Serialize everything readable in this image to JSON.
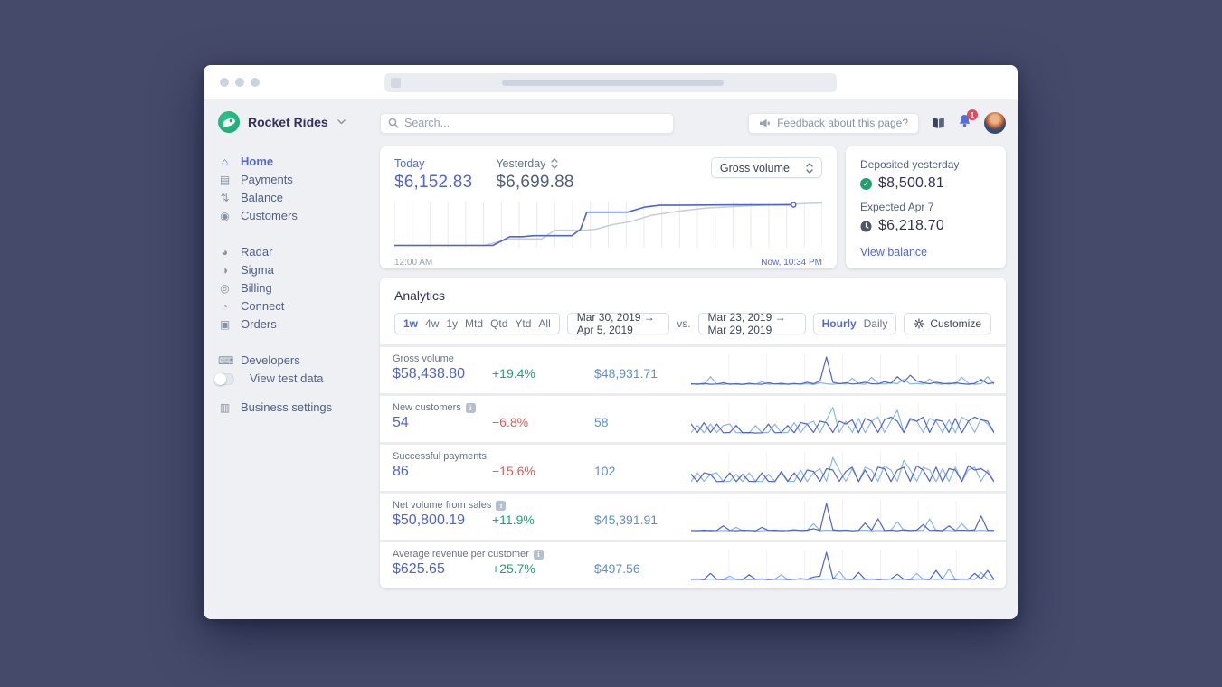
{
  "colors": {
    "accent": "#4f63d2",
    "comparison_text": "#5d8fdb",
    "spark_previous": "#8ab6ef",
    "yesterday_line": "#c7cdd8",
    "positive": "#1ba672",
    "negative": "#e25950"
  },
  "sidebar": {
    "account_name": "Rocket Rides",
    "nav_main": [
      {
        "label": "Home",
        "glyph": "⌂",
        "active": true
      },
      {
        "label": "Payments",
        "glyph": "▤"
      },
      {
        "label": "Balance",
        "glyph": "⇅"
      },
      {
        "label": "Customers",
        "glyph": "◉"
      }
    ],
    "nav_products": [
      {
        "label": "Radar",
        "glyph": "◕"
      },
      {
        "label": "Sigma",
        "glyph": "◑"
      },
      {
        "label": "Billing",
        "glyph": "◎"
      },
      {
        "label": "Connect",
        "glyph": "◔"
      },
      {
        "label": "Orders",
        "glyph": "▣"
      }
    ],
    "nav_dev": [
      {
        "label": "Developers",
        "glyph": "⌨"
      }
    ],
    "test_toggle_label": "View test data",
    "nav_settings": [
      {
        "label": "Business settings",
        "glyph": "▥"
      }
    ]
  },
  "topbar": {
    "search_placeholder": "Search...",
    "feedback_label": "Feedback about this page?",
    "notification_count": "1"
  },
  "overview": {
    "today_label": "Today",
    "today_value": "$6,152.83",
    "yesterday_label": "Yesterday",
    "yesterday_value": "$6,699.88",
    "metric_select": "Gross volume",
    "x_start": "12:00 AM",
    "x_end": "Now, 10:34 PM",
    "chart": {
      "today": [
        [
          0,
          0.05
        ],
        [
          0.23,
          0.05
        ],
        [
          0.27,
          0.24
        ],
        [
          0.3,
          0.24
        ],
        [
          0.325,
          0.26
        ],
        [
          0.415,
          0.26
        ],
        [
          0.435,
          0.4
        ],
        [
          0.45,
          0.77
        ],
        [
          0.545,
          0.77
        ],
        [
          0.585,
          0.88
        ],
        [
          0.62,
          0.92
        ],
        [
          0.8,
          0.93
        ],
        [
          0.933,
          0.93
        ]
      ],
      "yesterday": [
        [
          0,
          0.05
        ],
        [
          0.21,
          0.05
        ],
        [
          0.27,
          0.19
        ],
        [
          0.345,
          0.19
        ],
        [
          0.375,
          0.38
        ],
        [
          0.44,
          0.38
        ],
        [
          0.47,
          0.4
        ],
        [
          0.51,
          0.5
        ],
        [
          0.55,
          0.56
        ],
        [
          0.6,
          0.7
        ],
        [
          0.67,
          0.8
        ],
        [
          0.73,
          0.86
        ],
        [
          0.83,
          0.91
        ],
        [
          1.0,
          0.97
        ]
      ]
    }
  },
  "deposits": {
    "deposited_label": "Deposited yesterday",
    "deposited_value": "$8,500.81",
    "expected_label": "Expected Apr 7",
    "expected_value": "$6,218.70",
    "link_label": "View balance"
  },
  "analytics": {
    "title": "Analytics",
    "periods": [
      "1w",
      "4w",
      "1y",
      "Mtd",
      "Qtd",
      "Ytd",
      "All"
    ],
    "active_period": "1w",
    "range_current": "Mar 30, 2019 →  Apr 5, 2019",
    "vs_label": "vs.",
    "range_previous": "Mar 23, 2019 → Mar 29, 2019",
    "granularities": [
      "Hourly",
      "Daily"
    ],
    "active_granularity": "Hourly",
    "customize_label": "Customize",
    "rows": [
      {
        "label": "Gross volume",
        "info": false,
        "current": "$58,438.80",
        "delta": "+19.4%",
        "positive": true,
        "previous": "$48,931.71",
        "spark_current": [
          0.05,
          0.03,
          0.06,
          0.03,
          0.04,
          0.08,
          0.03,
          0.05,
          0.03,
          0.06,
          0.04,
          0.03,
          0.08,
          0.04,
          0.06,
          0.03,
          0.05,
          0.04,
          0.1,
          0.05,
          0.15,
          1.0,
          0.1,
          0.05,
          0.08,
          0.04,
          0.06,
          0.1,
          0.05,
          0.04,
          0.12,
          0.06,
          0.3,
          0.1,
          0.35,
          0.15,
          0.08,
          0.05,
          0.1,
          0.06,
          0.04,
          0.08,
          0.05,
          0.03,
          0.06,
          0.2,
          0.05,
          0.08
        ],
        "spark_previous": [
          0.03,
          0.05,
          0.02,
          0.3,
          0.04,
          0.02,
          0.05,
          0.03,
          0.02,
          0.04,
          0.03,
          0.12,
          0.03,
          0.05,
          0.02,
          0.04,
          0.06,
          0.03,
          0.05,
          0.02,
          0.08,
          0.05,
          0.03,
          0.06,
          0.04,
          0.25,
          0.05,
          0.03,
          0.28,
          0.06,
          0.04,
          0.08,
          0.05,
          0.2,
          0.04,
          0.06,
          0.03,
          0.22,
          0.05,
          0.03,
          0.08,
          0.04,
          0.28,
          0.06,
          0.03,
          0.05,
          0.3,
          0.04
        ]
      },
      {
        "label": "New customers",
        "info": true,
        "current": "54",
        "delta": "−6.8%",
        "positive": false,
        "previous": "58",
        "spark_current": [
          0.35,
          0.05,
          0.4,
          0.05,
          0.35,
          0.04,
          0.05,
          0.3,
          0.04,
          0.05,
          0.03,
          0.04,
          0.35,
          0.04,
          0.05,
          0.3,
          0.04,
          0.4,
          0.35,
          0.05,
          0.45,
          0.4,
          0.05,
          0.45,
          0.35,
          0.5,
          0.04,
          0.55,
          0.45,
          0.05,
          0.5,
          0.6,
          0.45,
          0.05,
          0.55,
          0.45,
          0.6,
          0.05,
          0.5,
          0.45,
          0.05,
          0.55,
          0.04,
          0.45,
          0.6,
          0.5,
          0.45,
          0.05
        ],
        "spark_previous": [
          0.05,
          0.3,
          0.04,
          0.35,
          0.05,
          0.3,
          0.35,
          0.04,
          0.05,
          0.03,
          0.3,
          0.04,
          0.05,
          0.35,
          0.04,
          0.05,
          0.4,
          0.05,
          0.35,
          0.45,
          0.05,
          0.5,
          0.95,
          0.05,
          0.45,
          0.05,
          0.55,
          0.04,
          0.45,
          0.6,
          0.05,
          0.45,
          0.85,
          0.05,
          0.5,
          0.45,
          0.05,
          0.55,
          0.45,
          0.05,
          0.5,
          0.04,
          0.6,
          0.45,
          0.05,
          0.55,
          0.35,
          0.04
        ]
      },
      {
        "label": "Successful payments",
        "info": false,
        "current": "86",
        "delta": "−15.6%",
        "positive": false,
        "previous": "102",
        "spark_current": [
          0.3,
          0.04,
          0.35,
          0.3,
          0.04,
          0.05,
          0.35,
          0.04,
          0.3,
          0.05,
          0.04,
          0.35,
          0.05,
          0.04,
          0.4,
          0.05,
          0.35,
          0.04,
          0.45,
          0.4,
          0.05,
          0.5,
          0.45,
          0.05,
          0.4,
          0.55,
          0.04,
          0.45,
          0.05,
          0.55,
          0.5,
          0.04,
          0.45,
          0.55,
          0.05,
          0.6,
          0.45,
          0.05,
          0.55,
          0.04,
          0.5,
          0.45,
          0.05,
          0.6,
          0.45,
          0.5,
          0.35,
          0.04
        ],
        "spark_previous": [
          0.04,
          0.35,
          0.05,
          0.3,
          0.35,
          0.04,
          0.05,
          0.3,
          0.04,
          0.35,
          0.05,
          0.04,
          0.3,
          0.05,
          0.35,
          0.04,
          0.05,
          0.45,
          0.04,
          0.35,
          0.5,
          0.05,
          0.9,
          0.45,
          0.05,
          0.5,
          0.04,
          0.55,
          0.45,
          0.05,
          0.6,
          0.45,
          0.05,
          0.8,
          0.45,
          0.05,
          0.55,
          0.45,
          0.04,
          0.5,
          0.05,
          0.55,
          0.04,
          0.45,
          0.55,
          0.05,
          0.45,
          0.04
        ]
      },
      {
        "label": "Net volume from sales",
        "info": true,
        "current": "$50,800.19",
        "delta": "+11.9%",
        "positive": true,
        "previous": "$45,391.91",
        "spark_current": [
          0.04,
          0.03,
          0.05,
          0.03,
          0.04,
          0.2,
          0.04,
          0.03,
          0.05,
          0.04,
          0.03,
          0.15,
          0.04,
          0.05,
          0.03,
          0.04,
          0.06,
          0.04,
          0.05,
          0.1,
          0.04,
          1.0,
          0.06,
          0.04,
          0.05,
          0.03,
          0.04,
          0.3,
          0.05,
          0.45,
          0.04,
          0.05,
          0.03,
          0.06,
          0.04,
          0.05,
          0.25,
          0.04,
          0.05,
          0.03,
          0.2,
          0.04,
          0.05,
          0.04,
          0.06,
          0.55,
          0.05,
          0.04
        ],
        "spark_previous": [
          0.03,
          0.04,
          0.02,
          0.05,
          0.03,
          0.04,
          0.03,
          0.15,
          0.03,
          0.04,
          0.02,
          0.03,
          0.05,
          0.03,
          0.04,
          0.03,
          0.05,
          0.03,
          0.04,
          0.28,
          0.03,
          0.05,
          0.04,
          0.03,
          0.05,
          0.03,
          0.04,
          0.05,
          0.03,
          0.04,
          0.03,
          0.05,
          0.35,
          0.04,
          0.03,
          0.05,
          0.04,
          0.45,
          0.03,
          0.05,
          0.04,
          0.03,
          0.28,
          0.04,
          0.03,
          0.05,
          0.03,
          0.04
        ]
      },
      {
        "label": "Average revenue per customer",
        "info": true,
        "current": "$625.65",
        "delta": "+25.7%",
        "positive": true,
        "previous": "$497.56",
        "spark_current": [
          0.04,
          0.05,
          0.03,
          0.25,
          0.04,
          0.03,
          0.05,
          0.04,
          0.03,
          0.2,
          0.04,
          0.05,
          0.03,
          0.04,
          0.05,
          0.03,
          0.04,
          0.06,
          0.04,
          0.12,
          0.15,
          1.0,
          0.08,
          0.04,
          0.05,
          0.03,
          0.28,
          0.04,
          0.05,
          0.03,
          0.04,
          0.05,
          0.22,
          0.04,
          0.03,
          0.05,
          0.04,
          0.03,
          0.35,
          0.05,
          0.04,
          0.03,
          0.05,
          0.04,
          0.25,
          0.05,
          0.35,
          0.04
        ],
        "spark_previous": [
          0.03,
          0.04,
          0.02,
          0.05,
          0.03,
          0.04,
          0.15,
          0.03,
          0.04,
          0.02,
          0.03,
          0.05,
          0.03,
          0.04,
          0.2,
          0.03,
          0.04,
          0.05,
          0.03,
          0.04,
          0.03,
          0.05,
          0.04,
          0.32,
          0.03,
          0.05,
          0.04,
          0.03,
          0.05,
          0.03,
          0.04,
          0.05,
          0.03,
          0.04,
          0.03,
          0.25,
          0.04,
          0.05,
          0.03,
          0.04,
          0.4,
          0.03,
          0.04,
          0.05,
          0.03,
          0.28,
          0.04,
          0.03
        ]
      }
    ]
  }
}
